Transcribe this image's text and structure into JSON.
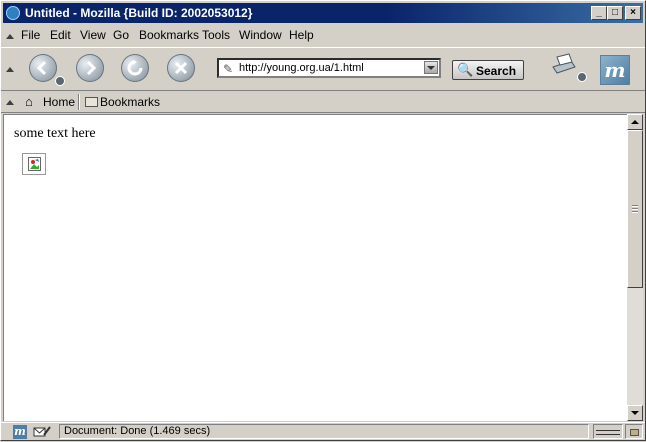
{
  "window": {
    "title": "Untitled - Mozilla {Build ID: 2002053012}",
    "controls": {
      "minimize": "_",
      "maximize": "□",
      "close": "×"
    }
  },
  "menu": {
    "items": [
      {
        "label": "File"
      },
      {
        "label": "Edit"
      },
      {
        "label": "View"
      },
      {
        "label": "Go"
      },
      {
        "label": "Bookmarks"
      },
      {
        "label": "Tools"
      },
      {
        "label": "Window"
      },
      {
        "label": "Help"
      }
    ]
  },
  "navigation": {
    "url": "http://young.org.ua/1.html",
    "search_label": "Search",
    "logo_letter": "m"
  },
  "personal_toolbar": {
    "home_label": "Home",
    "bookmarks_label": "Bookmarks"
  },
  "content": {
    "text": "some text here",
    "image": "broken-image-icon"
  },
  "status": {
    "text": "Document: Done (1.469 secs)"
  },
  "colors": {
    "titlebar": "#0a246a",
    "chrome": "#d4d0c8",
    "accent": "#4d7ea3"
  }
}
